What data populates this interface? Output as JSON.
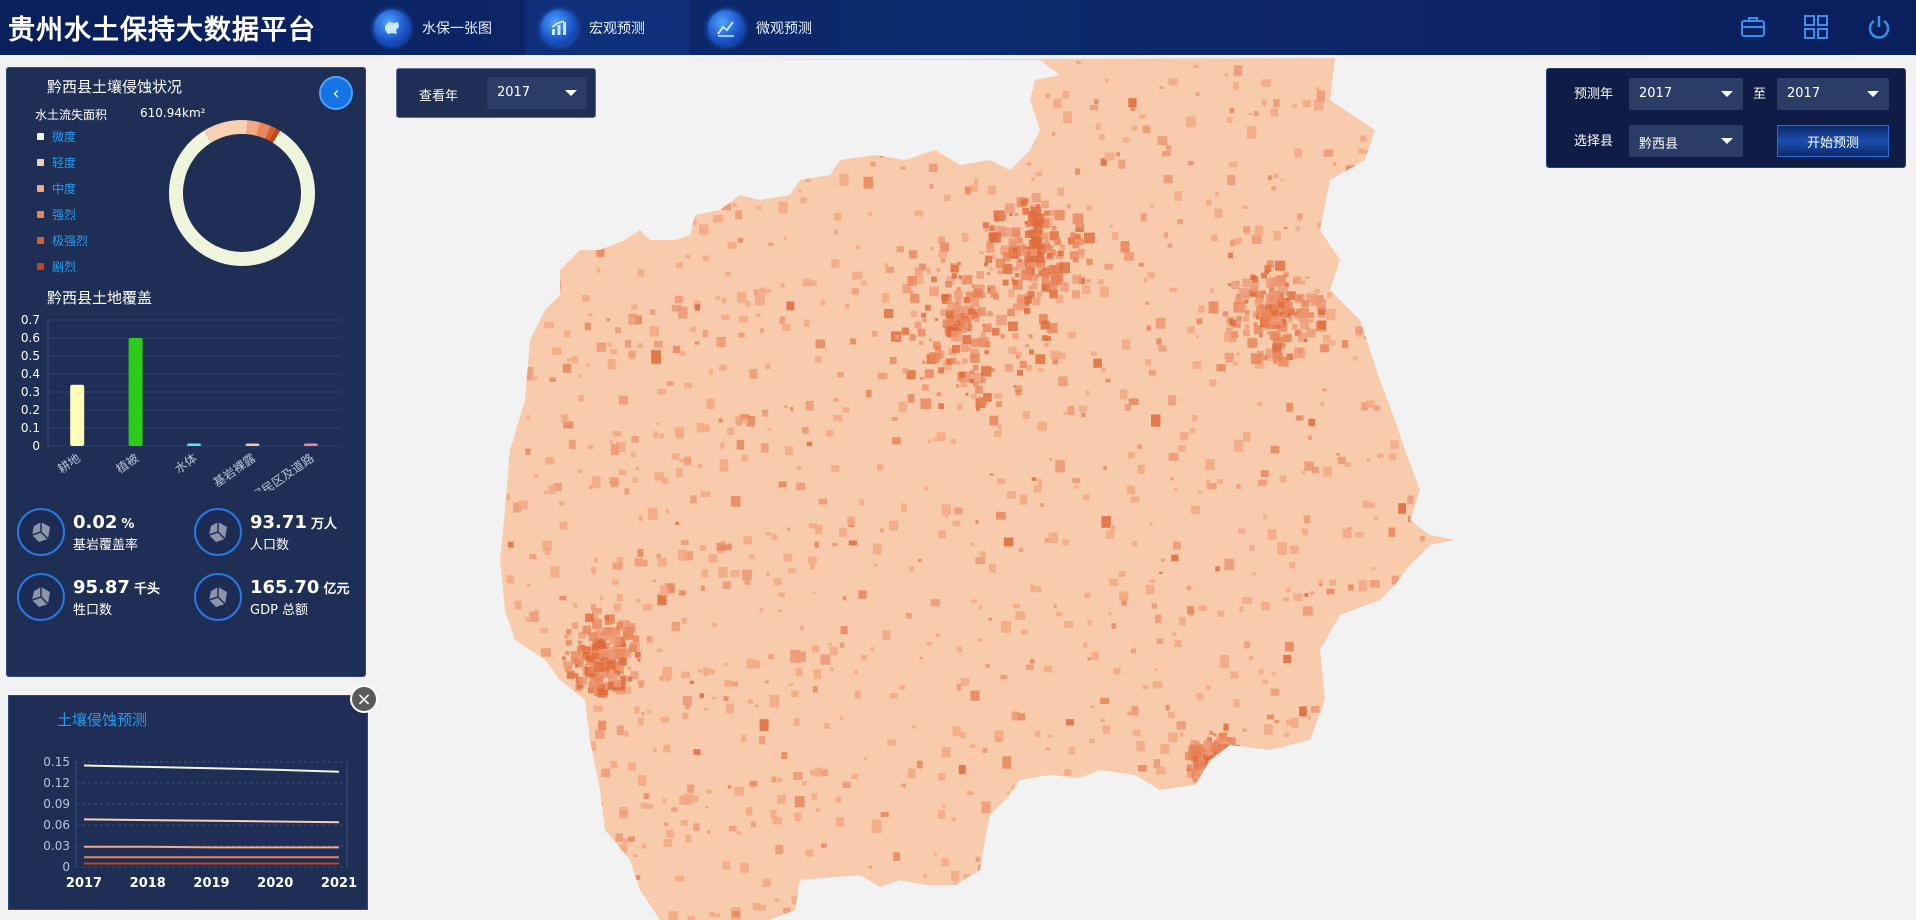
{
  "header": {
    "title": "贵州水土保持大数据平台",
    "tabs": [
      {
        "label": "水保一张图",
        "icon": "china-map-icon"
      },
      {
        "label": "宏观预测",
        "icon": "bar-chart-icon"
      },
      {
        "label": "微观预测",
        "icon": "line-chart-icon"
      }
    ],
    "active_tab": 1,
    "right_icons": [
      "briefcase-icon",
      "grid-icon",
      "power-icon"
    ]
  },
  "erosion": {
    "title": "黔西县土壤侵蚀状况",
    "area_label": "水土流失面积",
    "area_value": "610.94km²",
    "legend": [
      {
        "label": "微度",
        "color": "#eef5dc"
      },
      {
        "label": "轻度",
        "color": "#f8d0b4"
      },
      {
        "label": "中度",
        "color": "#f2a882"
      },
      {
        "label": "强烈",
        "color": "#e9855a"
      },
      {
        "label": "极强烈",
        "color": "#d9602c"
      },
      {
        "label": "剧烈",
        "color": "#c0451b"
      }
    ]
  },
  "land_cover": {
    "title": "黔西县土地覆盖"
  },
  "stats": [
    {
      "value": "0.02",
      "unit": "%",
      "label": "基岩覆盖率"
    },
    {
      "value": "93.71",
      "unit": "万人",
      "label": "人口数"
    },
    {
      "value": "95.87",
      "unit": "千头",
      "label": "牲口数"
    },
    {
      "value": "165.70",
      "unit": "亿元",
      "label": "GDP 总额"
    }
  ],
  "prediction": {
    "title": "土壤侵蚀预测"
  },
  "view_year": {
    "label": "查看年",
    "value": "2017"
  },
  "forecast": {
    "year_label": "预测年",
    "from_year": "2017",
    "to_label": "至",
    "to_year": "2017",
    "county_label": "选择县",
    "county": "黔西县",
    "start_label": "开始预测"
  },
  "chart_data": [
    {
      "type": "pie",
      "title": "",
      "categories": [
        "微度",
        "轻度",
        "中度",
        "强烈",
        "极强烈",
        "剧烈"
      ],
      "values": [
        82.5,
        10.0,
        2.8,
        2.5,
        1.2,
        1.0
      ],
      "colors": [
        "#eef5dc",
        "#f8d0b4",
        "#f2a882",
        "#e9855a",
        "#d9602c",
        "#c0451b"
      ]
    },
    {
      "type": "bar",
      "title": "黔西县土地覆盖",
      "categories": [
        "耕地",
        "植被",
        "水体",
        "基岩裸露",
        "居民区及道路"
      ],
      "values": [
        0.34,
        0.6,
        0.005,
        0.01,
        0.012
      ],
      "colors": [
        "#fffcb8",
        "#2ecc1a",
        "#5fe3f0",
        "#f2c6b4",
        "#f08a9a"
      ],
      "ylim": [
        0,
        0.7
      ],
      "yticks": [
        "0",
        "0.1",
        "0.2",
        "0.3",
        "0.4",
        "0.5",
        "0.6",
        "0.7"
      ]
    },
    {
      "type": "line",
      "title": "土壤侵蚀预测",
      "x": [
        "2017",
        "2018",
        "2019",
        "2020",
        "2021"
      ],
      "ylim": [
        0,
        0.15
      ],
      "yticks": [
        "0",
        "0.03",
        "0.06",
        "0.09",
        "0.12",
        "0.15"
      ],
      "series": [
        {
          "values": [
            0.145,
            0.143,
            0.141,
            0.139,
            0.136
          ],
          "color": "#eef5dc"
        },
        {
          "values": [
            0.068,
            0.067,
            0.066,
            0.065,
            0.064
          ],
          "color": "#f8d0b4"
        },
        {
          "values": [
            0.029,
            0.029,
            0.028,
            0.028,
            0.028
          ],
          "color": "#f2a882"
        },
        {
          "values": [
            0.014,
            0.014,
            0.014,
            0.014,
            0.014
          ],
          "color": "#e9855a"
        },
        {
          "values": [
            0.005,
            0.005,
            0.005,
            0.005,
            0.005
          ],
          "color": "#c0451b"
        }
      ]
    }
  ]
}
